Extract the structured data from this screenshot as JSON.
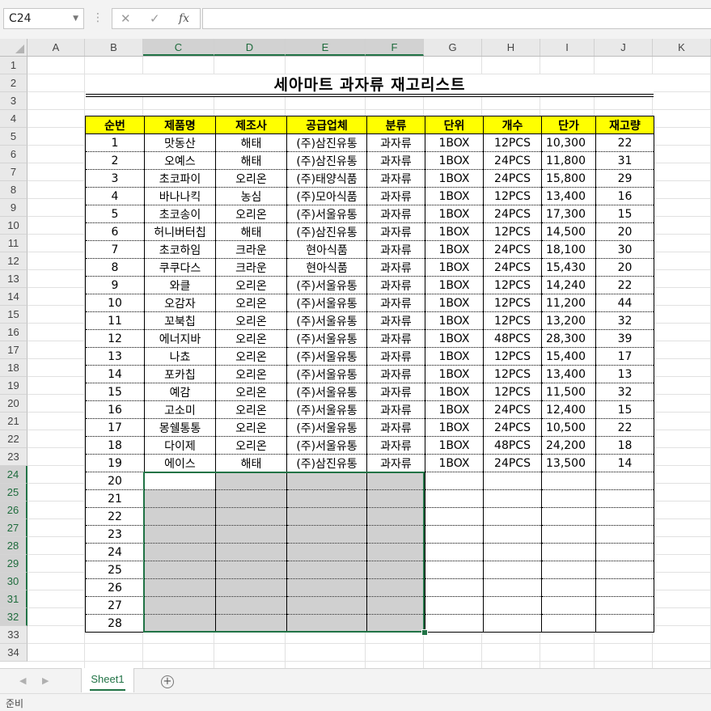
{
  "formula_bar": {
    "name_box": "C24",
    "cancel_icon": "✕",
    "enter_icon": "✓",
    "function_icon": "fx",
    "formula": ""
  },
  "columns": [
    "A",
    "B",
    "C",
    "D",
    "E",
    "F",
    "G",
    "H",
    "I",
    "J",
    "K"
  ],
  "rows": [
    "1",
    "2",
    "3",
    "4",
    "5",
    "6",
    "7",
    "8",
    "9",
    "10",
    "11",
    "12",
    "13",
    "14",
    "15",
    "16",
    "17",
    "18",
    "19",
    "20",
    "21",
    "22",
    "23",
    "24",
    "25",
    "26",
    "27",
    "28",
    "29",
    "30",
    "31",
    "32",
    "33",
    "34"
  ],
  "title": "세아마트 과자류 재고리스트",
  "headers": [
    "순번",
    "제품명",
    "제조사",
    "공급업체",
    "분류",
    "단위",
    "개수",
    "단가",
    "재고량"
  ],
  "records": [
    [
      "1",
      "맛동산",
      "해태",
      "(주)삼진유통",
      "과자류",
      "1BOX",
      "12PCS",
      "10,300",
      "22"
    ],
    [
      "2",
      "오예스",
      "해태",
      "(주)삼진유통",
      "과자류",
      "1BOX",
      "24PCS",
      "11,800",
      "31"
    ],
    [
      "3",
      "초코파이",
      "오리온",
      "(주)태양식품",
      "과자류",
      "1BOX",
      "24PCS",
      "15,800",
      "29"
    ],
    [
      "4",
      "바나나킥",
      "농심",
      "(주)모아식품",
      "과자류",
      "1BOX",
      "12PCS",
      "13,400",
      "16"
    ],
    [
      "5",
      "초코송이",
      "오리온",
      "(주)서울유통",
      "과자류",
      "1BOX",
      "24PCS",
      "17,300",
      "15"
    ],
    [
      "6",
      "허니버터칩",
      "해태",
      "(주)삼진유통",
      "과자류",
      "1BOX",
      "12PCS",
      "14,500",
      "20"
    ],
    [
      "7",
      "초코하임",
      "크라운",
      "현아식품",
      "과자류",
      "1BOX",
      "24PCS",
      "18,100",
      "30"
    ],
    [
      "8",
      "쿠쿠다스",
      "크라운",
      "현아식품",
      "과자류",
      "1BOX",
      "24PCS",
      "15,430",
      "20"
    ],
    [
      "9",
      "와클",
      "오리온",
      "(주)서울유통",
      "과자류",
      "1BOX",
      "12PCS",
      "14,240",
      "22"
    ],
    [
      "10",
      "오감자",
      "오리온",
      "(주)서울유통",
      "과자류",
      "1BOX",
      "12PCS",
      "11,200",
      "44"
    ],
    [
      "11",
      "꼬북칩",
      "오리온",
      "(주)서울유통",
      "과자류",
      "1BOX",
      "12PCS",
      "13,200",
      "32"
    ],
    [
      "12",
      "에너지바",
      "오리온",
      "(주)서울유통",
      "과자류",
      "1BOX",
      "48PCS",
      "28,300",
      "39"
    ],
    [
      "13",
      "나쵸",
      "오리온",
      "(주)서울유통",
      "과자류",
      "1BOX",
      "12PCS",
      "15,400",
      "17"
    ],
    [
      "14",
      "포카칩",
      "오리온",
      "(주)서울유통",
      "과자류",
      "1BOX",
      "12PCS",
      "13,400",
      "13"
    ],
    [
      "15",
      "예감",
      "오리온",
      "(주)서울유통",
      "과자류",
      "1BOX",
      "12PCS",
      "11,500",
      "32"
    ],
    [
      "16",
      "고소미",
      "오리온",
      "(주)서울유통",
      "과자류",
      "1BOX",
      "24PCS",
      "12,400",
      "15"
    ],
    [
      "17",
      "몽쉘통통",
      "오리온",
      "(주)서울유통",
      "과자류",
      "1BOX",
      "24PCS",
      "10,500",
      "22"
    ],
    [
      "18",
      "다이제",
      "오리온",
      "(주)서울유통",
      "과자류",
      "1BOX",
      "48PCS",
      "24,200",
      "18"
    ],
    [
      "19",
      "에이스",
      "해태",
      "(주)삼진유통",
      "과자류",
      "1BOX",
      "24PCS",
      "13,500",
      "14"
    ],
    [
      "20",
      "",
      "",
      "",
      "",
      "",
      "",
      "",
      ""
    ],
    [
      "21",
      "",
      "",
      "",
      "",
      "",
      "",
      "",
      ""
    ],
    [
      "22",
      "",
      "",
      "",
      "",
      "",
      "",
      "",
      ""
    ],
    [
      "23",
      "",
      "",
      "",
      "",
      "",
      "",
      "",
      ""
    ],
    [
      "24",
      "",
      "",
      "",
      "",
      "",
      "",
      "",
      ""
    ],
    [
      "25",
      "",
      "",
      "",
      "",
      "",
      "",
      "",
      ""
    ],
    [
      "26",
      "",
      "",
      "",
      "",
      "",
      "",
      "",
      ""
    ],
    [
      "27",
      "",
      "",
      "",
      "",
      "",
      "",
      "",
      ""
    ],
    [
      "28",
      "",
      "",
      "",
      "",
      "",
      "",
      "",
      ""
    ]
  ],
  "sheet_tab": "Sheet1",
  "add_sheet_icon": "+",
  "nav_prev_icon": "◀",
  "nav_next_icon": "▶",
  "status": "준비",
  "colors": {
    "header_fill": "#ffff00",
    "selection_fill": "#d0d0d0",
    "accent": "#217346"
  }
}
